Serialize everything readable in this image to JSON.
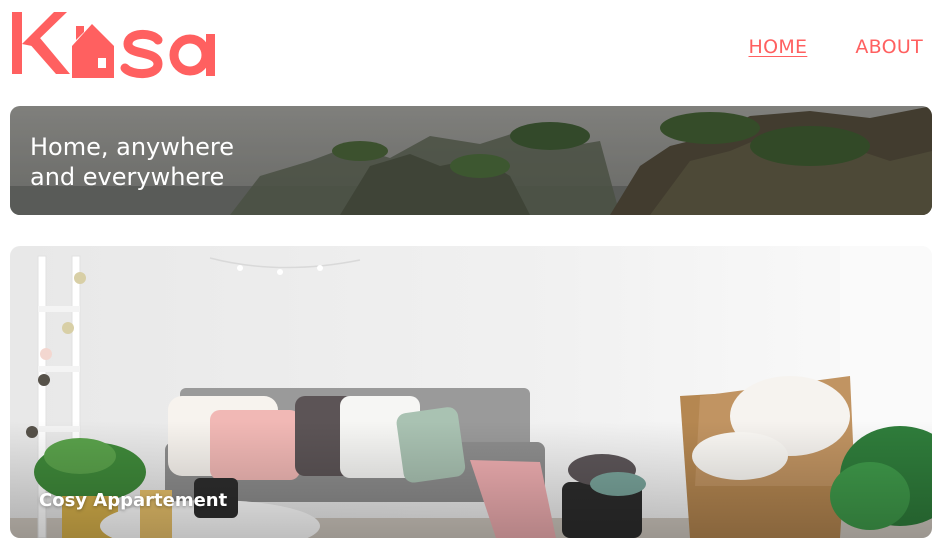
{
  "brand": {
    "name": "Kasa",
    "color": "#FF6060"
  },
  "nav": {
    "items": [
      {
        "label": "HOME",
        "active": true
      },
      {
        "label": "ABOUT",
        "active": false
      }
    ]
  },
  "banner": {
    "title": "Home, anywhere\nand everywhere"
  },
  "listings": [
    {
      "title": "Cosy Appartement"
    }
  ]
}
